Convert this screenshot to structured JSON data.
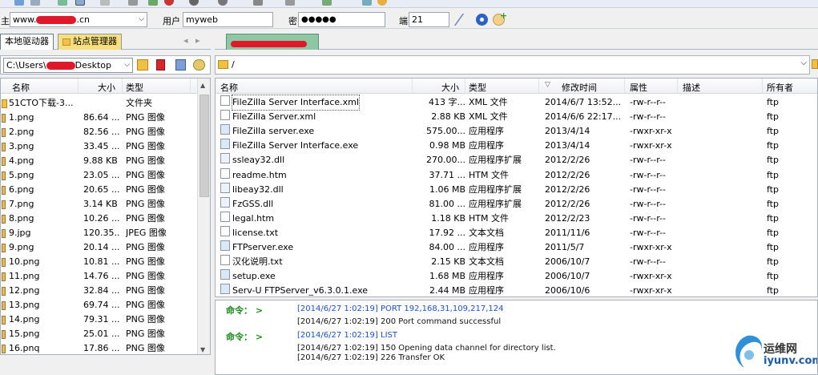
{
  "connect_bar": {
    "host_label": "主",
    "host_value_pre": "www.",
    "host_value_post": ".cn",
    "user_label": "用户",
    "user_value": "myweb",
    "pass_label": "密",
    "pass_value": "●●●●●",
    "port_label": "端",
    "port_value": "21"
  },
  "local_tabs": {
    "active": "本地驱动器",
    "other": "站点管理器"
  },
  "local_path": "C:\\Users\\",
  "local_path_suffix": "Desktop",
  "local_headers": {
    "name": "名称",
    "size": "大小",
    "type": "类型"
  },
  "local_files": [
    {
      "name": "51CTO下载-3...",
      "size": "",
      "type": "文件夹",
      "kind": "folder"
    },
    {
      "name": "1.png",
      "size": "86.64 ...",
      "type": "PNG 图像",
      "kind": "img"
    },
    {
      "name": "2.png",
      "size": "82.56 ...",
      "type": "PNG 图像",
      "kind": "img"
    },
    {
      "name": "3.png",
      "size": "33.45 ...",
      "type": "PNG 图像",
      "kind": "img"
    },
    {
      "name": "4.png",
      "size": "9.88 KB",
      "type": "PNG 图像",
      "kind": "img"
    },
    {
      "name": "5.png",
      "size": "23.05 ...",
      "type": "PNG 图像",
      "kind": "img"
    },
    {
      "name": "6.png",
      "size": "20.65 ...",
      "type": "PNG 图像",
      "kind": "img"
    },
    {
      "name": "7.png",
      "size": "3.14 KB",
      "type": "PNG 图像",
      "kind": "img"
    },
    {
      "name": "8.png",
      "size": "10.26 ...",
      "type": "PNG 图像",
      "kind": "img"
    },
    {
      "name": "9.jpg",
      "size": "120.35...",
      "type": "JPEG 图像",
      "kind": "img"
    },
    {
      "name": "9.png",
      "size": "20.14 ...",
      "type": "PNG 图像",
      "kind": "img"
    },
    {
      "name": "10.png",
      "size": "10.81 ...",
      "type": "PNG 图像",
      "kind": "img"
    },
    {
      "name": "11.png",
      "size": "14.76 ...",
      "type": "PNG 图像",
      "kind": "img"
    },
    {
      "name": "12.png",
      "size": "32.84 ...",
      "type": "PNG 图像",
      "kind": "img"
    },
    {
      "name": "13.png",
      "size": "69.74 ...",
      "type": "PNG 图像",
      "kind": "img"
    },
    {
      "name": "14.png",
      "size": "79.31 ...",
      "type": "PNG 图像",
      "kind": "img"
    },
    {
      "name": "15.png",
      "size": "25.01 ...",
      "type": "PNG 图像",
      "kind": "img"
    },
    {
      "name": "16.pnq",
      "size": "17.86 ...",
      "type": "PNG 图像",
      "kind": "img"
    }
  ],
  "remote_path": "/",
  "remote_headers": {
    "name": "名称",
    "size": "大小",
    "type": "类型",
    "mtime": "修改时间",
    "attr": "属性",
    "desc": "描述",
    "owner": "所有者"
  },
  "remote_files": [
    {
      "name": "FileZilla Server Interface.xml",
      "size": "413 字...",
      "type": "XML 文件",
      "mtime": "2014/6/7 13:52...",
      "attr": "-rw-r--r--",
      "owner": "ftp",
      "kind": "doc"
    },
    {
      "name": "FileZilla Server.xml",
      "size": "2.88 KB",
      "type": "XML 文件",
      "mtime": "2014/6/6 22:17...",
      "attr": "-rw-r--r--",
      "owner": "ftp",
      "kind": "doc"
    },
    {
      "name": "FileZilla server.exe",
      "size": "575.00...",
      "type": "应用程序",
      "mtime": "2013/4/14",
      "attr": "-rwxr-xr-x",
      "owner": "ftp",
      "kind": "exe"
    },
    {
      "name": "FileZilla Server Interface.exe",
      "size": "0.98 MB",
      "type": "应用程序",
      "mtime": "2013/4/14",
      "attr": "-rwxr-xr-x",
      "owner": "ftp",
      "kind": "exe"
    },
    {
      "name": "ssleay32.dll",
      "size": "270.00...",
      "type": "应用程序扩展",
      "mtime": "2012/2/26",
      "attr": "-rw-r--r--",
      "owner": "ftp",
      "kind": "dll"
    },
    {
      "name": "readme.htm",
      "size": "37.71 ...",
      "type": "HTM 文件",
      "mtime": "2012/2/26",
      "attr": "-rw-r--r--",
      "owner": "ftp",
      "kind": "doc"
    },
    {
      "name": "libeay32.dll",
      "size": "1.06 MB",
      "type": "应用程序扩展",
      "mtime": "2012/2/26",
      "attr": "-rw-r--r--",
      "owner": "ftp",
      "kind": "dll"
    },
    {
      "name": "FzGSS.dll",
      "size": "81.00 ...",
      "type": "应用程序扩展",
      "mtime": "2012/2/26",
      "attr": "-rw-r--r--",
      "owner": "ftp",
      "kind": "dll"
    },
    {
      "name": "legal.htm",
      "size": "1.18 KB",
      "type": "HTM 文件",
      "mtime": "2012/2/23",
      "attr": "-rw-r--r--",
      "owner": "ftp",
      "kind": "doc"
    },
    {
      "name": "license.txt",
      "size": "17.92 ...",
      "type": "文本文档",
      "mtime": "2011/11/6",
      "attr": "-rw-r--r--",
      "owner": "ftp",
      "kind": "doc"
    },
    {
      "name": "FTPserver.exe",
      "size": "84.00 ...",
      "type": "应用程序",
      "mtime": "2011/5/7",
      "attr": "-rwxr-xr-x",
      "owner": "ftp",
      "kind": "exe"
    },
    {
      "name": "汉化说明.txt",
      "size": "2.15 KB",
      "type": "文本文档",
      "mtime": "2006/10/7",
      "attr": "-rw-r--r--",
      "owner": "ftp",
      "kind": "doc"
    },
    {
      "name": "setup.exe",
      "size": "1.68 MB",
      "type": "应用程序",
      "mtime": "2006/10/7",
      "attr": "-rwxr-xr-x",
      "owner": "ftp",
      "kind": "exe"
    },
    {
      "name": "Serv-U FTPServer_v6.3.0.1.exe",
      "size": "2.44 MB",
      "type": "应用程序",
      "mtime": "2006/10/6",
      "attr": "-rwxr-xr-x",
      "owner": "ftp",
      "kind": "exe"
    }
  ],
  "log": [
    {
      "label": "命令： >",
      "ts": "[2014/6/27 1:02:19]",
      "text": "PORT 192,168,31,109,217,124",
      "color": "#1a4fd0"
    },
    {
      "label": "",
      "ts": "[2014/6/27 1:02:19]",
      "text": "200 Port command successful",
      "color": "#111111"
    },
    {
      "label": "命令： >",
      "ts": "[2014/6/27 1:02:19]",
      "text": "LIST",
      "color": "#1a4fd0"
    },
    {
      "label": "",
      "ts": "[2014/6/27 1:02:19]",
      "text": "150 Opening data channel for directory list.",
      "color": "#111111"
    },
    {
      "label": "",
      "ts": "[2014/6/27 1:02:19]",
      "text": "226 Transfer OK",
      "color": "#111111"
    }
  ],
  "watermark": {
    "cn": "运维网",
    "en": "iyunv.com"
  },
  "colors": {
    "log_label": "#1a8a1a",
    "accent": "#2f8fd8",
    "tab_remote": "#8fc6a3"
  }
}
